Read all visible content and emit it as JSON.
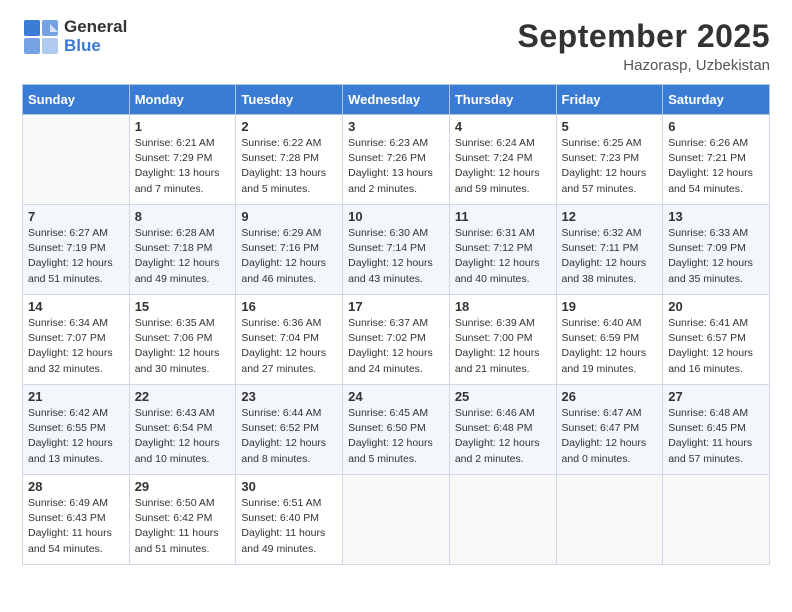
{
  "header": {
    "logo_general": "General",
    "logo_blue": "Blue",
    "title": "September 2025",
    "location": "Hazorasp, Uzbekistan"
  },
  "weekdays": [
    "Sunday",
    "Monday",
    "Tuesday",
    "Wednesday",
    "Thursday",
    "Friday",
    "Saturday"
  ],
  "weeks": [
    [
      {
        "day": "",
        "sunrise": "",
        "sunset": "",
        "daylight": ""
      },
      {
        "day": "1",
        "sunrise": "Sunrise: 6:21 AM",
        "sunset": "Sunset: 7:29 PM",
        "daylight": "Daylight: 13 hours and 7 minutes."
      },
      {
        "day": "2",
        "sunrise": "Sunrise: 6:22 AM",
        "sunset": "Sunset: 7:28 PM",
        "daylight": "Daylight: 13 hours and 5 minutes."
      },
      {
        "day": "3",
        "sunrise": "Sunrise: 6:23 AM",
        "sunset": "Sunset: 7:26 PM",
        "daylight": "Daylight: 13 hours and 2 minutes."
      },
      {
        "day": "4",
        "sunrise": "Sunrise: 6:24 AM",
        "sunset": "Sunset: 7:24 PM",
        "daylight": "Daylight: 12 hours and 59 minutes."
      },
      {
        "day": "5",
        "sunrise": "Sunrise: 6:25 AM",
        "sunset": "Sunset: 7:23 PM",
        "daylight": "Daylight: 12 hours and 57 minutes."
      },
      {
        "day": "6",
        "sunrise": "Sunrise: 6:26 AM",
        "sunset": "Sunset: 7:21 PM",
        "daylight": "Daylight: 12 hours and 54 minutes."
      }
    ],
    [
      {
        "day": "7",
        "sunrise": "Sunrise: 6:27 AM",
        "sunset": "Sunset: 7:19 PM",
        "daylight": "Daylight: 12 hours and 51 minutes."
      },
      {
        "day": "8",
        "sunrise": "Sunrise: 6:28 AM",
        "sunset": "Sunset: 7:18 PM",
        "daylight": "Daylight: 12 hours and 49 minutes."
      },
      {
        "day": "9",
        "sunrise": "Sunrise: 6:29 AM",
        "sunset": "Sunset: 7:16 PM",
        "daylight": "Daylight: 12 hours and 46 minutes."
      },
      {
        "day": "10",
        "sunrise": "Sunrise: 6:30 AM",
        "sunset": "Sunset: 7:14 PM",
        "daylight": "Daylight: 12 hours and 43 minutes."
      },
      {
        "day": "11",
        "sunrise": "Sunrise: 6:31 AM",
        "sunset": "Sunset: 7:12 PM",
        "daylight": "Daylight: 12 hours and 40 minutes."
      },
      {
        "day": "12",
        "sunrise": "Sunrise: 6:32 AM",
        "sunset": "Sunset: 7:11 PM",
        "daylight": "Daylight: 12 hours and 38 minutes."
      },
      {
        "day": "13",
        "sunrise": "Sunrise: 6:33 AM",
        "sunset": "Sunset: 7:09 PM",
        "daylight": "Daylight: 12 hours and 35 minutes."
      }
    ],
    [
      {
        "day": "14",
        "sunrise": "Sunrise: 6:34 AM",
        "sunset": "Sunset: 7:07 PM",
        "daylight": "Daylight: 12 hours and 32 minutes."
      },
      {
        "day": "15",
        "sunrise": "Sunrise: 6:35 AM",
        "sunset": "Sunset: 7:06 PM",
        "daylight": "Daylight: 12 hours and 30 minutes."
      },
      {
        "day": "16",
        "sunrise": "Sunrise: 6:36 AM",
        "sunset": "Sunset: 7:04 PM",
        "daylight": "Daylight: 12 hours and 27 minutes."
      },
      {
        "day": "17",
        "sunrise": "Sunrise: 6:37 AM",
        "sunset": "Sunset: 7:02 PM",
        "daylight": "Daylight: 12 hours and 24 minutes."
      },
      {
        "day": "18",
        "sunrise": "Sunrise: 6:39 AM",
        "sunset": "Sunset: 7:00 PM",
        "daylight": "Daylight: 12 hours and 21 minutes."
      },
      {
        "day": "19",
        "sunrise": "Sunrise: 6:40 AM",
        "sunset": "Sunset: 6:59 PM",
        "daylight": "Daylight: 12 hours and 19 minutes."
      },
      {
        "day": "20",
        "sunrise": "Sunrise: 6:41 AM",
        "sunset": "Sunset: 6:57 PM",
        "daylight": "Daylight: 12 hours and 16 minutes."
      }
    ],
    [
      {
        "day": "21",
        "sunrise": "Sunrise: 6:42 AM",
        "sunset": "Sunset: 6:55 PM",
        "daylight": "Daylight: 12 hours and 13 minutes."
      },
      {
        "day": "22",
        "sunrise": "Sunrise: 6:43 AM",
        "sunset": "Sunset: 6:54 PM",
        "daylight": "Daylight: 12 hours and 10 minutes."
      },
      {
        "day": "23",
        "sunrise": "Sunrise: 6:44 AM",
        "sunset": "Sunset: 6:52 PM",
        "daylight": "Daylight: 12 hours and 8 minutes."
      },
      {
        "day": "24",
        "sunrise": "Sunrise: 6:45 AM",
        "sunset": "Sunset: 6:50 PM",
        "daylight": "Daylight: 12 hours and 5 minutes."
      },
      {
        "day": "25",
        "sunrise": "Sunrise: 6:46 AM",
        "sunset": "Sunset: 6:48 PM",
        "daylight": "Daylight: 12 hours and 2 minutes."
      },
      {
        "day": "26",
        "sunrise": "Sunrise: 6:47 AM",
        "sunset": "Sunset: 6:47 PM",
        "daylight": "Daylight: 12 hours and 0 minutes."
      },
      {
        "day": "27",
        "sunrise": "Sunrise: 6:48 AM",
        "sunset": "Sunset: 6:45 PM",
        "daylight": "Daylight: 11 hours and 57 minutes."
      }
    ],
    [
      {
        "day": "28",
        "sunrise": "Sunrise: 6:49 AM",
        "sunset": "Sunset: 6:43 PM",
        "daylight": "Daylight: 11 hours and 54 minutes."
      },
      {
        "day": "29",
        "sunrise": "Sunrise: 6:50 AM",
        "sunset": "Sunset: 6:42 PM",
        "daylight": "Daylight: 11 hours and 51 minutes."
      },
      {
        "day": "30",
        "sunrise": "Sunrise: 6:51 AM",
        "sunset": "Sunset: 6:40 PM",
        "daylight": "Daylight: 11 hours and 49 minutes."
      },
      {
        "day": "",
        "sunrise": "",
        "sunset": "",
        "daylight": ""
      },
      {
        "day": "",
        "sunrise": "",
        "sunset": "",
        "daylight": ""
      },
      {
        "day": "",
        "sunrise": "",
        "sunset": "",
        "daylight": ""
      },
      {
        "day": "",
        "sunrise": "",
        "sunset": "",
        "daylight": ""
      }
    ]
  ]
}
